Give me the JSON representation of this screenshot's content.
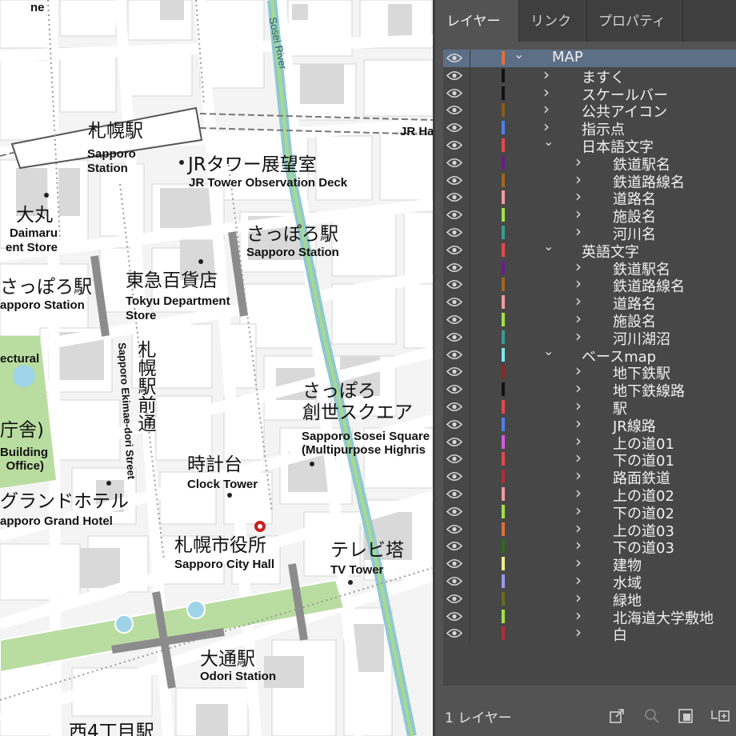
{
  "map": {
    "labels": {
      "sapporo_station_jp": "札幌駅",
      "sapporo_station_en": "Sapporo\nStation",
      "jr_tower_jp": "JRタワー展望室",
      "jr_tower_en": "JR Tower Observation Deck",
      "daimaru_jp": "大丸",
      "daimaru_en": "Daimaru\nent Store",
      "sapporo_sta2_jp": "さっぽろ駅",
      "sapporo_sta2_en": "Sapporo Station",
      "tokyu_jp": "東急百貨店",
      "tokyu_en": "Tokyu Department\nStore",
      "sapporo_sta3_jp": "さっぽろ駅",
      "sapporo_sta3_en": "apporo Station",
      "ectural": "ectural",
      "ekimae_jp": "札幌駅前通",
      "ekimae_en": "Sapporo Ekimae-dori Street",
      "sosei_jp": "さっぽろ\n創世スクエア",
      "sosei_en": "Sapporo Sosei Square\n(Multipurpose Highris",
      "building_jp": "庁舎)",
      "building_en": "Building\nOffice)",
      "clock_jp": "時計台",
      "clock_en": "Clock Tower",
      "grand_jp": "グランドホテル",
      "grand_en": "apporo Grand Hotel",
      "city_hall_jp": "札幌市役所",
      "city_hall_en": "Sapporo City Hall",
      "tv_jp": "テレビ塔",
      "tv_en": "TV Tower",
      "odori_jp": "大通駅",
      "odori_en": "Odori Station",
      "nishi4_jp": "西4丁目駅",
      "jr_ha": "JR Ha",
      "ne": "ne",
      "river": "Sosei River"
    }
  },
  "panel": {
    "tabs": [
      {
        "label": "レイヤー",
        "active": true
      },
      {
        "label": "リンク",
        "active": false
      },
      {
        "label": "プロパティ",
        "active": false
      }
    ],
    "layers": [
      {
        "name": "MAP",
        "level": 0,
        "expanded": true,
        "color": "#e0703a",
        "selected": true
      },
      {
        "name": "ますく",
        "level": 1,
        "expanded": false,
        "color": "#111111"
      },
      {
        "name": "スケールバー",
        "level": 1,
        "expanded": false,
        "color": "#111111"
      },
      {
        "name": "公共アイコン",
        "level": 1,
        "expanded": false,
        "color": "#8a5a1e"
      },
      {
        "name": "指示点",
        "level": 1,
        "expanded": false,
        "color": "#4f7fe8"
      },
      {
        "name": "日本語文字",
        "level": 1,
        "expanded": true,
        "color": "#e04a4a"
      },
      {
        "name": "鉄道駅名",
        "level": 2,
        "expanded": false,
        "color": "#6a1e86"
      },
      {
        "name": "鉄道路線名",
        "level": 2,
        "expanded": false,
        "color": "#a0661e"
      },
      {
        "name": "道路名",
        "level": 2,
        "expanded": false,
        "color": "#f09aa0"
      },
      {
        "name": "施設名",
        "level": 2,
        "expanded": false,
        "color": "#a2e24a"
      },
      {
        "name": "河川名",
        "level": 2,
        "expanded": false,
        "color": "#3a9a96"
      },
      {
        "name": "英語文字",
        "level": 1,
        "expanded": true,
        "color": "#e04a4a"
      },
      {
        "name": "鉄道駅名",
        "level": 2,
        "expanded": false,
        "color": "#6a1e86"
      },
      {
        "name": "鉄道路線名",
        "level": 2,
        "expanded": false,
        "color": "#a0661e"
      },
      {
        "name": "道路名",
        "level": 2,
        "expanded": false,
        "color": "#f09aa0"
      },
      {
        "name": "施設名",
        "level": 2,
        "expanded": false,
        "color": "#a2e24a"
      },
      {
        "name": "河川湖沼",
        "level": 2,
        "expanded": false,
        "color": "#3a9a96"
      },
      {
        "name": "ベースmap",
        "level": 1,
        "expanded": true,
        "color": "#7fe8ee"
      },
      {
        "name": "地下鉄駅",
        "level": 2,
        "expanded": false,
        "color": "#8a2a22"
      },
      {
        "name": "地下鉄線路",
        "level": 2,
        "expanded": false,
        "color": "#111111"
      },
      {
        "name": "駅",
        "level": 2,
        "expanded": false,
        "color": "#e04a4a"
      },
      {
        "name": "JR線路",
        "level": 2,
        "expanded": false,
        "color": "#4f7fe8"
      },
      {
        "name": "上の道01",
        "level": 2,
        "expanded": false,
        "color": "#d25ae0"
      },
      {
        "name": "下の道01",
        "level": 2,
        "expanded": false,
        "color": "#e04a4a"
      },
      {
        "name": "路面鉄道",
        "level": 2,
        "expanded": false,
        "color": "#b32e3a"
      },
      {
        "name": "上の道02",
        "level": 2,
        "expanded": false,
        "color": "#f09aa0"
      },
      {
        "name": "下の道02",
        "level": 2,
        "expanded": false,
        "color": "#a2e24a"
      },
      {
        "name": "上の道03",
        "level": 2,
        "expanded": false,
        "color": "#e0703a"
      },
      {
        "name": "下の道03",
        "level": 2,
        "expanded": false,
        "color": "#2e6a1e"
      },
      {
        "name": "建物",
        "level": 2,
        "expanded": false,
        "color": "#eef08a"
      },
      {
        "name": "水域",
        "level": 2,
        "expanded": false,
        "color": "#9a9af0"
      },
      {
        "name": "緑地",
        "level": 2,
        "expanded": false,
        "color": "#6a6a1e"
      },
      {
        "name": "北海道大学敷地",
        "level": 2,
        "expanded": false,
        "color": "#a2e24a"
      },
      {
        "name": "白",
        "level": 2,
        "expanded": false,
        "color": "#b32e3a"
      }
    ],
    "footer": {
      "layer_count": "1 レイヤー",
      "icons": [
        "export-icon",
        "search-icon",
        "clip-mask-icon",
        "new-sublayer-icon"
      ]
    }
  }
}
